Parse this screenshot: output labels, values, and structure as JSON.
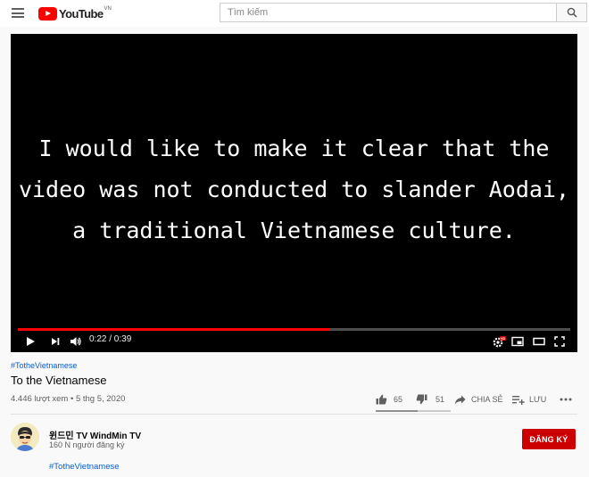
{
  "header": {
    "logo_text": "YouTube",
    "logo_region": "VN",
    "search_placeholder": "Tìm kiếm"
  },
  "player": {
    "caption": "I would like to make it clear that the\nvideo was not conducted to slander Aodai,\na traditional Vietnamese culture.",
    "current_time": "0:22",
    "duration": "0:39",
    "time_display": "0:22 / 0:39",
    "progress_fraction": 0.564
  },
  "video": {
    "hashtag": "#TotheVietnamese",
    "title": "To the Vietnamese",
    "views": "4.446 lượt xem",
    "date": "5 thg 5, 2020",
    "meta_line": "4.446 lượt xem • 5 thg 5, 2020"
  },
  "actions": {
    "likes": "65",
    "dislikes": "51",
    "share_label": "CHIA SẺ",
    "save_label": "LƯU",
    "like_ratio": 0.56
  },
  "channel": {
    "name": "윈드민 TV WindMin TV",
    "subscribers": "160 N người đăng ký",
    "subscribe_label": "ĐĂNG KÝ"
  },
  "description": {
    "hashtag": "#TotheVietnamese"
  },
  "colors": {
    "brand_red": "#ff0000",
    "subscribe_red": "#cc0000",
    "link_blue": "#065fd4"
  },
  "icons": [
    "menu-icon",
    "youtube-logo-icon",
    "search-icon",
    "play-icon",
    "next-icon",
    "volume-icon",
    "settings-icon",
    "miniplayer-icon",
    "theater-icon",
    "fullscreen-icon",
    "like-icon",
    "dislike-icon",
    "share-icon",
    "save-playlist-icon",
    "more-icon"
  ]
}
